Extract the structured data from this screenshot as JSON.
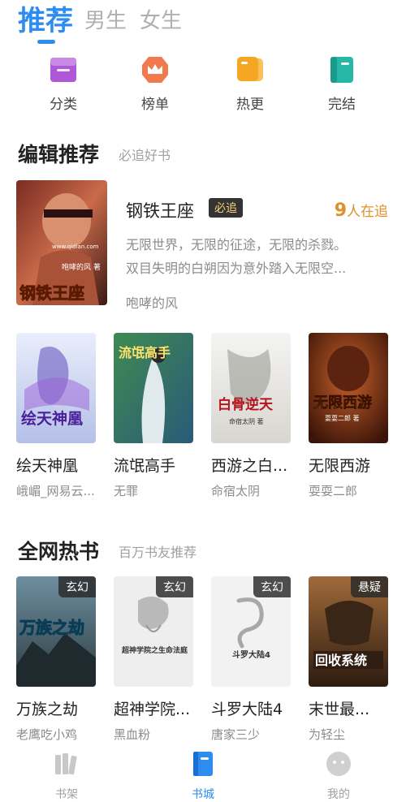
{
  "top_tabs": [
    "推荐",
    "男生",
    "女生"
  ],
  "categories": [
    {
      "label": "分类",
      "icon": "folder-icon",
      "color": "#b057d8"
    },
    {
      "label": "榜单",
      "icon": "crown-icon",
      "color": "#f07a4e"
    },
    {
      "label": "热更",
      "icon": "tag-icon",
      "color": "#f5a623"
    },
    {
      "label": "完结",
      "icon": "book-icon",
      "color": "#26b8a6"
    }
  ],
  "editor_section": {
    "title": "编辑推荐",
    "subtitle": "必追好书",
    "featured": {
      "title": "钢铁王座",
      "badge": "必追",
      "count_num": "9",
      "count_suffix": "人在追",
      "desc_line1": "无限世界，无限的征途，无限的杀戮。",
      "desc_line2": "双目失明的白朔因为意外踏入无限空...",
      "author": "咆哮的风",
      "cover_text_small": "www.qidian.com",
      "cover_text_author": "咆哮的风  著",
      "cover_text_big": "钢铁王座"
    },
    "books": [
      {
        "title": "绘天神凰",
        "author": "峨嵋_网易云...",
        "cover_text": "绘天神凰"
      },
      {
        "title": "流氓高手",
        "author": "无罪",
        "cover_text": "流氓高手"
      },
      {
        "title": "西游之白...",
        "author": "命宿太阴",
        "cover_text": "白骨逆天",
        "cover_sub": "命宿太阴 著"
      },
      {
        "title": "无限西游",
        "author": "耍耍二郎",
        "cover_text": "无限西游",
        "cover_sub": "耍耍二郎 著"
      }
    ]
  },
  "hot_section": {
    "title": "全网热书",
    "subtitle": "百万书友推荐",
    "books": [
      {
        "title": "万族之劫",
        "author": "老鹰吃小鸡",
        "genre": "玄幻",
        "cover_text": "万族之劫"
      },
      {
        "title": "超神学院...",
        "author": "黑血粉",
        "genre": "玄幻",
        "cover_text": "超神学院之生命法庭"
      },
      {
        "title": "斗罗大陆4",
        "author": "唐家三少",
        "genre": "玄幻",
        "cover_text": "斗罗大陆4"
      },
      {
        "title": "末世最...",
        "author": "为轻尘",
        "genre": "悬疑",
        "cover_text": "回收系统"
      }
    ]
  },
  "bottom_nav": [
    {
      "label": "书架",
      "icon": "bookshelf-icon"
    },
    {
      "label": "书城",
      "icon": "bookstore-icon"
    },
    {
      "label": "我的",
      "icon": "profile-icon"
    }
  ],
  "colors": {
    "accent": "#2d8cf0",
    "badge_text": "#ffd27a",
    "count": "#e0902a"
  }
}
